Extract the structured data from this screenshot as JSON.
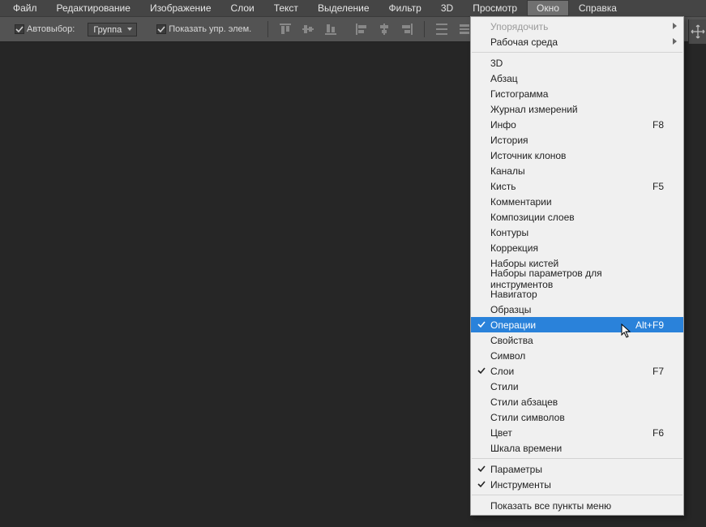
{
  "menubar": {
    "items": [
      {
        "label": "Файл"
      },
      {
        "label": "Редактирование"
      },
      {
        "label": "Изображение"
      },
      {
        "label": "Слои"
      },
      {
        "label": "Текст"
      },
      {
        "label": "Выделение"
      },
      {
        "label": "Фильтр"
      },
      {
        "label": "3D"
      },
      {
        "label": "Просмотр"
      },
      {
        "label": "Окно"
      },
      {
        "label": "Справка"
      }
    ],
    "active_index": 9
  },
  "optionsbar": {
    "auto_select_label": "Автовыбор:",
    "group_dropdown": "Группа",
    "show_controls_label": "Показать упр. элем."
  },
  "popup": {
    "items": [
      {
        "label": "Упорядочить",
        "disabled": true,
        "submenu": true
      },
      {
        "label": "Рабочая среда",
        "submenu": true
      },
      {
        "sep": true
      },
      {
        "label": "3D"
      },
      {
        "label": "Абзац"
      },
      {
        "label": "Гистограмма"
      },
      {
        "label": "Журнал измерений"
      },
      {
        "label": "Инфо",
        "shortcut": "F8"
      },
      {
        "label": "История"
      },
      {
        "label": "Источник клонов"
      },
      {
        "label": "Каналы"
      },
      {
        "label": "Кисть",
        "shortcut": "F5"
      },
      {
        "label": "Комментарии"
      },
      {
        "label": "Композиции слоев"
      },
      {
        "label": "Контуры"
      },
      {
        "label": "Коррекция"
      },
      {
        "label": "Наборы кистей"
      },
      {
        "label": "Наборы параметров для инструментов"
      },
      {
        "label": "Навигатор"
      },
      {
        "label": "Образцы"
      },
      {
        "label": "Операции",
        "shortcut": "Alt+F9",
        "checked": true,
        "highlight": true
      },
      {
        "label": "Свойства"
      },
      {
        "label": "Символ"
      },
      {
        "label": "Слои",
        "shortcut": "F7",
        "checked": true
      },
      {
        "label": "Стили"
      },
      {
        "label": "Стили абзацев"
      },
      {
        "label": "Стили символов"
      },
      {
        "label": "Цвет",
        "shortcut": "F6"
      },
      {
        "label": "Шкала времени"
      },
      {
        "sep": true
      },
      {
        "label": "Параметры",
        "checked": true
      },
      {
        "label": "Инструменты",
        "checked": true
      },
      {
        "sep": true
      },
      {
        "label": "Показать все пункты меню"
      }
    ]
  }
}
